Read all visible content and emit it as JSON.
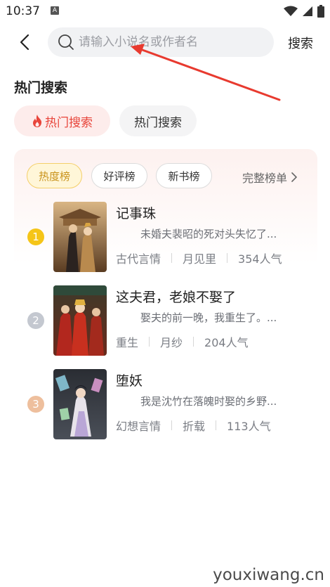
{
  "status_bar": {
    "time": "10:37",
    "notification_letter": "A"
  },
  "search": {
    "placeholder": "请输入小说名或作者名",
    "button_label": "搜索"
  },
  "hot_section": {
    "title": "热门搜索",
    "chips": [
      {
        "label": "热门搜索",
        "icon": "flame-icon",
        "color": "#e8453b"
      },
      {
        "label": "热门搜索"
      }
    ]
  },
  "ranking": {
    "tabs": [
      {
        "label": "热度榜",
        "active": true
      },
      {
        "label": "好评榜"
      },
      {
        "label": "新书榜"
      }
    ],
    "full_list_label": "完整榜单",
    "books": [
      {
        "rank": "1",
        "rank_color": "#f5c518",
        "title": "记事珠",
        "desc": "未婚夫裴昭的死对头失忆了...",
        "genre": "古代言情",
        "author": "月见里",
        "popularity": "354人气"
      },
      {
        "rank": "2",
        "rank_color": "#c4c8d0",
        "title": "这夫君，老娘不娶了",
        "desc": "娶夫的前一晚，我重生了。...",
        "genre": "重生",
        "author": "月纱",
        "popularity": "204人气"
      },
      {
        "rank": "3",
        "rank_color": "#eebf9d",
        "title": "堕妖",
        "desc": "我是沈竹在落魄时娶的乡野...",
        "genre": "幻想言情",
        "author": "折载",
        "popularity": "113人气"
      }
    ]
  },
  "annotation_arrow_color": "#e83a2f",
  "watermark": "youxiwang.cn"
}
